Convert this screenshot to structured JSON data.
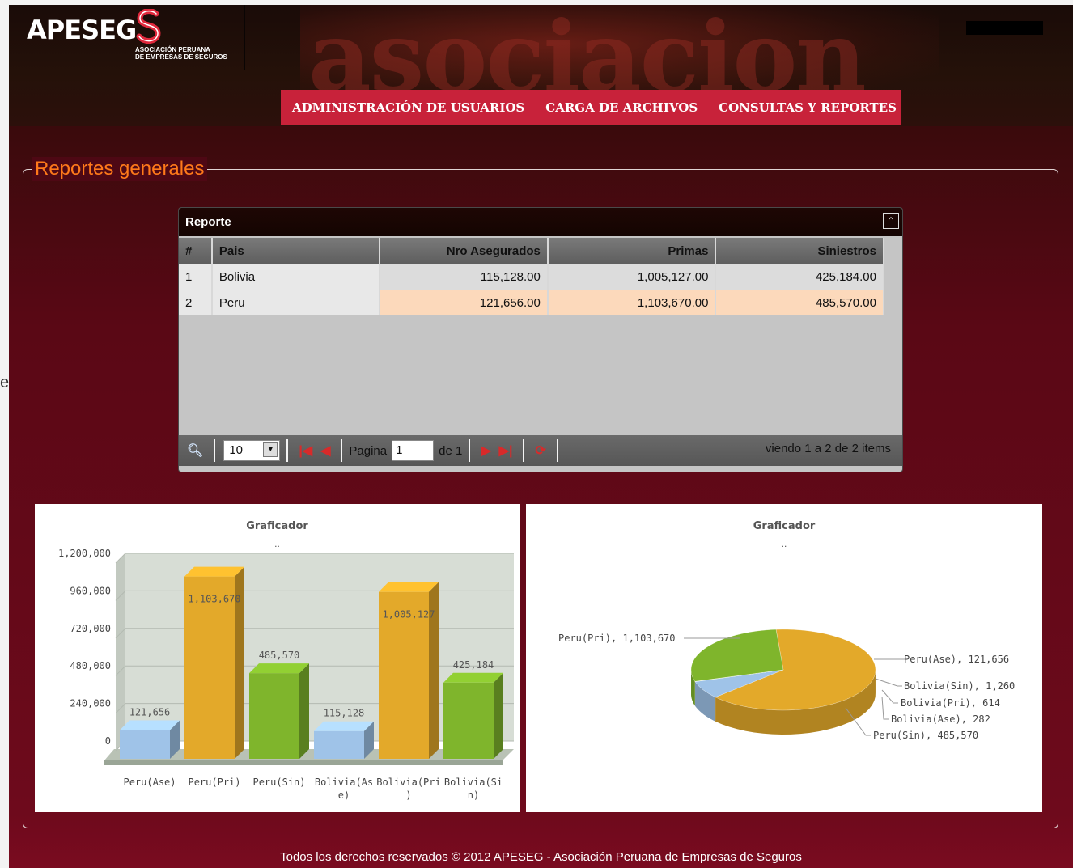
{
  "app": {
    "logo_text": "APESEG",
    "logo_tagline_1": "ASOCIACIÓN PERUANA",
    "logo_tagline_2": "DE EMPRESAS DE SEGUROS",
    "header_watermark": "asociacion"
  },
  "menu": {
    "items": [
      {
        "label": "ADMINISTRACIÓN DE USUARIOS"
      },
      {
        "label": "CARGA DE ARCHIVOS"
      },
      {
        "label": "CONSULTAS Y REPORTES"
      }
    ]
  },
  "panel": {
    "legend": "Reportes generales"
  },
  "grid": {
    "title": "Reporte",
    "columns": [
      "#",
      "Pais",
      "Nro Asegurados",
      "Primas",
      "Siniestros"
    ],
    "rows": [
      {
        "idx": "1",
        "pais": "Bolivia",
        "asegurados": "115,128.00",
        "primas": "1,005,127.00",
        "siniestros": "425,184.00"
      },
      {
        "idx": "2",
        "pais": "Peru",
        "asegurados": "121,656.00",
        "primas": "1,103,670.00",
        "siniestros": "485,570.00"
      }
    ],
    "pager": {
      "page_size": "10",
      "page_label": "Pagina",
      "page_value": "1",
      "of_label": "de 1",
      "info": "viendo 1 a 2 de 2 items"
    }
  },
  "charts": {
    "bar": {
      "title": "Graficador",
      "subtitle": ".."
    },
    "pie": {
      "title": "Graficador",
      "subtitle": ".."
    }
  },
  "chart_data": [
    {
      "type": "bar",
      "title": "Graficador",
      "subtitle": "..",
      "categories": [
        "Peru(Ase)",
        "Peru(Pri)",
        "Peru(Sin)",
        "Bolivia(Ase)",
        "Bolivia(Pri)",
        "Bolivia(Sin)"
      ],
      "category_lines": [
        [
          "Peru(Ase)"
        ],
        [
          "Peru(Pri)"
        ],
        [
          "Peru(Sin)"
        ],
        [
          "Bolivia(As",
          "e)"
        ],
        [
          "Bolivia(Pri",
          ")"
        ],
        [
          "Bolivia(Si",
          "n)"
        ]
      ],
      "values": [
        121656,
        1103670,
        485570,
        115128,
        1005127,
        425184
      ],
      "value_labels": [
        "121,656",
        "1,103,670",
        "485,570",
        "115,128",
        "1,005,127",
        "425,184"
      ],
      "yticks": [
        "0",
        "240,000",
        "480,000",
        "720,000",
        "960,000",
        "1,200,000"
      ],
      "ylim": [
        0,
        1200000
      ],
      "colors": [
        "#9fc3e8",
        "#e3a92a",
        "#7fb52c",
        "#9fc3e8",
        "#e3a92a",
        "#7fb52c"
      ],
      "grid": true
    },
    {
      "type": "pie",
      "title": "Graficador",
      "subtitle": "..",
      "slices": [
        {
          "label": "Peru(Pri), 1,103,670",
          "value": 1103670,
          "color": "#e3a92a"
        },
        {
          "label": "Peru(Ase), 121,656",
          "value": 121656,
          "color": "#9fc3e8"
        },
        {
          "label": "Bolivia(Sin), 1,260",
          "value": 1260,
          "color": "#7fb52c"
        },
        {
          "label": "Bolivia(Pri), 614",
          "value": 614,
          "color": "#e3a92a"
        },
        {
          "label": "Bolivia(Ase), 282",
          "value": 282,
          "color": "#9fc3e8"
        },
        {
          "label": "Peru(Sin), 485,570",
          "value": 485570,
          "color": "#7fb52c"
        }
      ]
    }
  ],
  "footer": {
    "text": "Todos los derechos reservados © 2012 APESEG - Asociación Peruana de Empresas de Seguros"
  }
}
